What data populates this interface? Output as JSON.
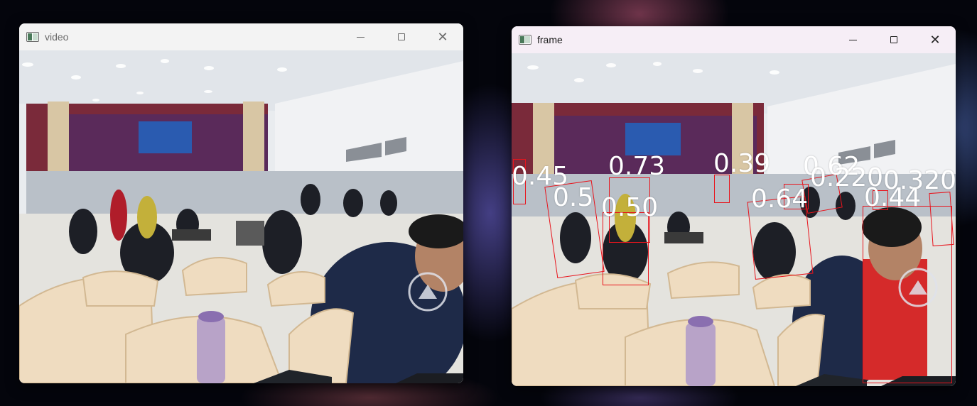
{
  "colors": {
    "detection_box": "#e8141c",
    "label_text": "#ffffff"
  },
  "windows": {
    "video": {
      "title": "video",
      "icon": "app-window-icon",
      "controls": {
        "minimize": "─",
        "maximize": "□",
        "close": "✕"
      }
    },
    "frame": {
      "title": "frame",
      "icon": "app-window-icon",
      "controls": {
        "minimize": "─",
        "maximize": "□",
        "close": "✕"
      },
      "detection_labels": [
        "0.45",
        "0.73",
        "0.39",
        "0.5",
        "0.50",
        "0.64",
        "0.62",
        "0.220",
        "0.320",
        "0.44"
      ]
    }
  }
}
